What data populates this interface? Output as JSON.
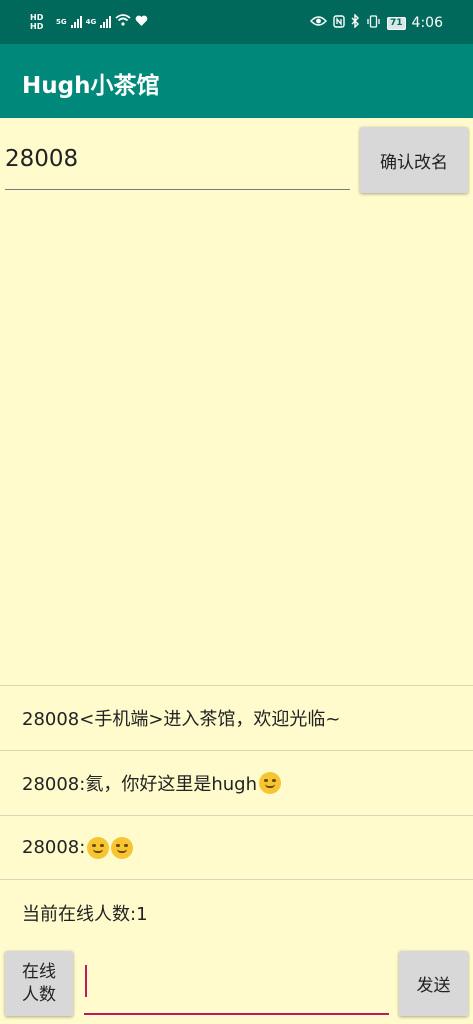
{
  "status_bar": {
    "hd_label_1": "HD",
    "hd_label_2": "HD",
    "network_1": "5G",
    "network_2": "4G",
    "battery": "71",
    "time": "4:06",
    "icons": [
      "signal-icon",
      "wifi-icon",
      "heart-icon",
      "eye-icon",
      "nfc-icon",
      "bluetooth-icon",
      "vibrate-icon",
      "battery-icon"
    ]
  },
  "app_bar": {
    "title": "Hugh小茶馆"
  },
  "rename": {
    "input_value": "28008",
    "button_label": "确认改名"
  },
  "chat": {
    "messages": [
      {
        "text": "28008<手机端>进入茶馆，欢迎光临~",
        "emoji": []
      },
      {
        "text": "28008:氦，你好这里是hugh",
        "emoji": [
          "smirking-face-icon"
        ]
      },
      {
        "text": "28008:",
        "emoji": [
          "hugging-face-icon",
          "hugging-face-icon"
        ]
      }
    ]
  },
  "online_count_text": "当前在线人数:1",
  "bottom_bar": {
    "online_button_label": "在线\n人数",
    "message_value": "",
    "send_button_label": "发送"
  },
  "colors": {
    "status_bar": "#00695C",
    "app_bar": "#00897B",
    "background": "#FFFBCC",
    "accent": "#C2185B",
    "button": "#D8D8D8"
  }
}
